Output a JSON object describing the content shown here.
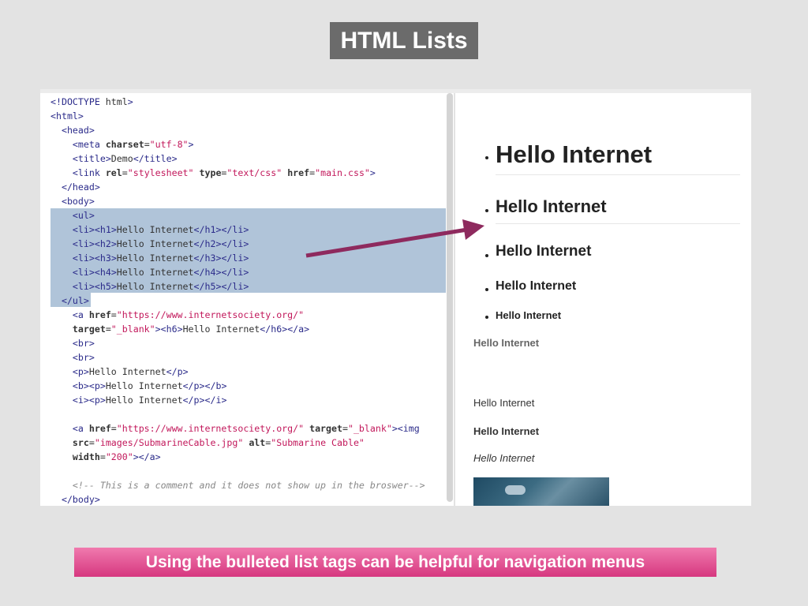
{
  "slide": {
    "title": "HTML Lists",
    "caption": "Using the bulleted list tags can be helpful for navigation menus"
  },
  "editor": {
    "lines": [
      "<!DOCTYPE html>",
      "<html>",
      "  <head>",
      "    <meta charset=\"utf-8\">",
      "    <title>Demo</title>",
      "    <link rel=\"stylesheet\" type=\"text/css\" href=\"main.css\">",
      "  </head>",
      "  <body>",
      "    <ul>",
      "    <li><h1>Hello Internet</h1></li>",
      "    <li><h2>Hello Internet</h2></li>",
      "    <li><h3>Hello Internet</h3></li>",
      "    <li><h4>Hello Internet</h4></li>",
      "    <li><h5>Hello Internet</h5></li>",
      "  </ul>",
      "    <a href=\"https://www.internetsociety.org/\"",
      "    target=\"_blank\"><h6>Hello Internet</h6></a>",
      "    <br>",
      "    <br>",
      "    <p>Hello Internet</p>",
      "    <b><p>Hello Internet</p></b>",
      "    <i><p>Hello Internet</p></i>",
      "",
      "    <a href=\"https://www.internetsociety.org/\" target=\"_blank\"><img",
      "    src=\"images/SubmarineCable.jpg\" alt=\"Submarine Cable\"",
      "    width=\"200\"></a>",
      "",
      "    <!-- This is a comment and it does not show up in the broswer-->",
      "  </body>"
    ]
  },
  "browser": {
    "list_items": [
      "Hello Internet",
      "Hello Internet",
      "Hello Internet",
      "Hello Internet",
      "Hello Internet"
    ],
    "h6_link": "Hello Internet",
    "paragraph": "Hello Internet",
    "bold_paragraph": "Hello Internet",
    "italic_paragraph": "Hello Internet"
  },
  "colors": {
    "title_bg": "#6b6b6b",
    "banner": "#e0498d",
    "selection": "#b0c4d9",
    "arrow": "#8e2a5e"
  }
}
